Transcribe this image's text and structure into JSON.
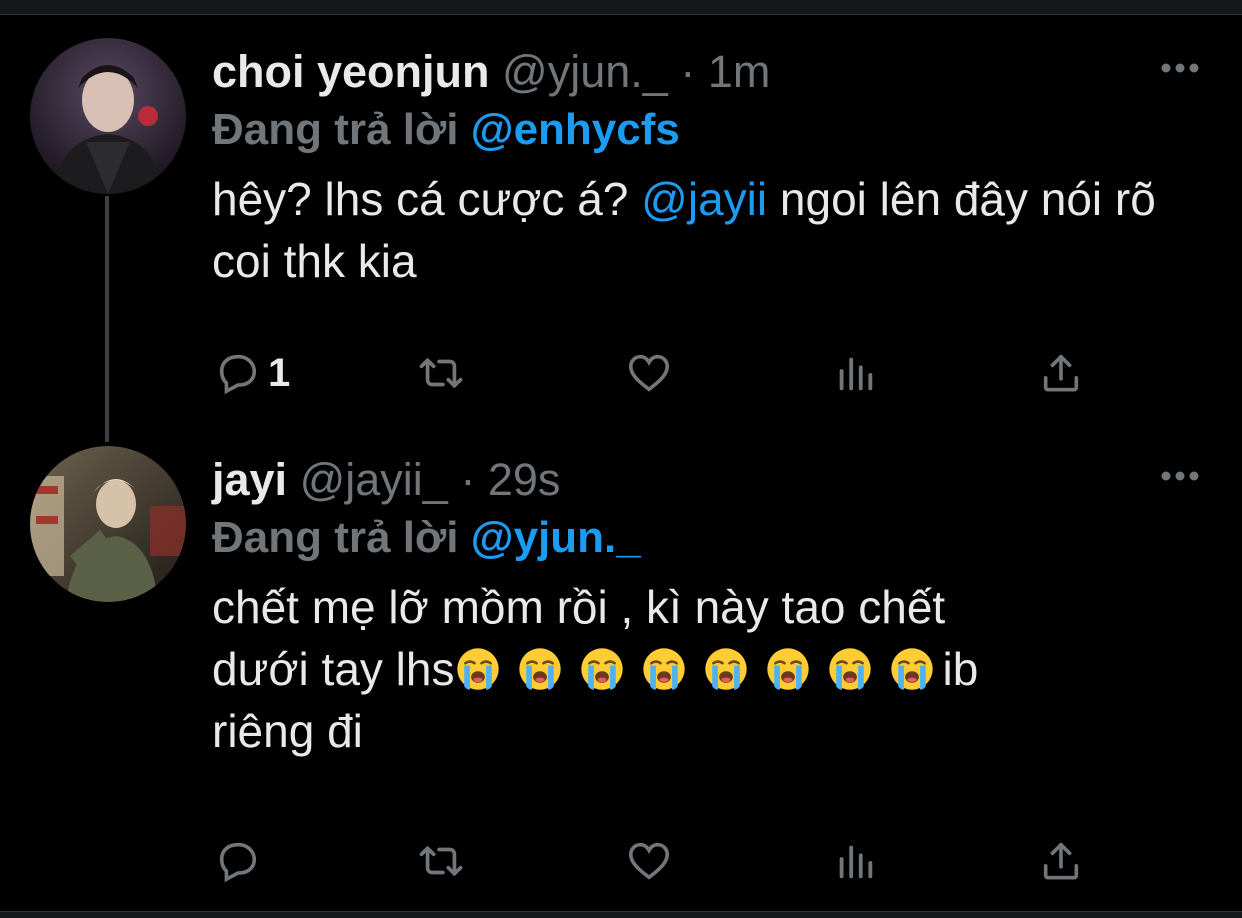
{
  "tweets": [
    {
      "display_name": "choi yeonjun",
      "handle": "@yjun._",
      "separator": "·",
      "time": "1m",
      "reply_prefix": "Đang trả lời",
      "reply_to": "@enhycfs",
      "text_before": "hêy? lhs cá cược á?",
      "mention": "@jayii",
      "text_after": "ngoi lên đây nói rõ coi thk kia",
      "reply_count": "1",
      "icons": {
        "more": "more-icon",
        "reply": "reply-icon",
        "retweet": "retweet-icon",
        "like": "heart-icon",
        "views": "views-icon",
        "share": "share-icon"
      }
    },
    {
      "display_name": "jayi",
      "handle": "@jayii_",
      "separator": "·",
      "time": "29s",
      "reply_prefix": "Đang trả lời",
      "reply_to": "@yjun._",
      "text_line1": "chết mẹ lỡ mồm rồi , kì này tao chết",
      "text_line2_before": "dưới tay lhs",
      "emoji": "😭",
      "emoji_count": 8,
      "text_line2_after": "ib",
      "text_line3": "riêng đi",
      "icons": {
        "more": "more-icon",
        "reply": "reply-icon",
        "retweet": "retweet-icon",
        "like": "heart-icon",
        "views": "views-icon",
        "share": "share-icon"
      }
    }
  ],
  "colors": {
    "background": "#000000",
    "text_primary": "#e7e9ea",
    "text_secondary": "#71767b",
    "accent": "#1d9bf0",
    "thread_line": "#3e4144"
  }
}
